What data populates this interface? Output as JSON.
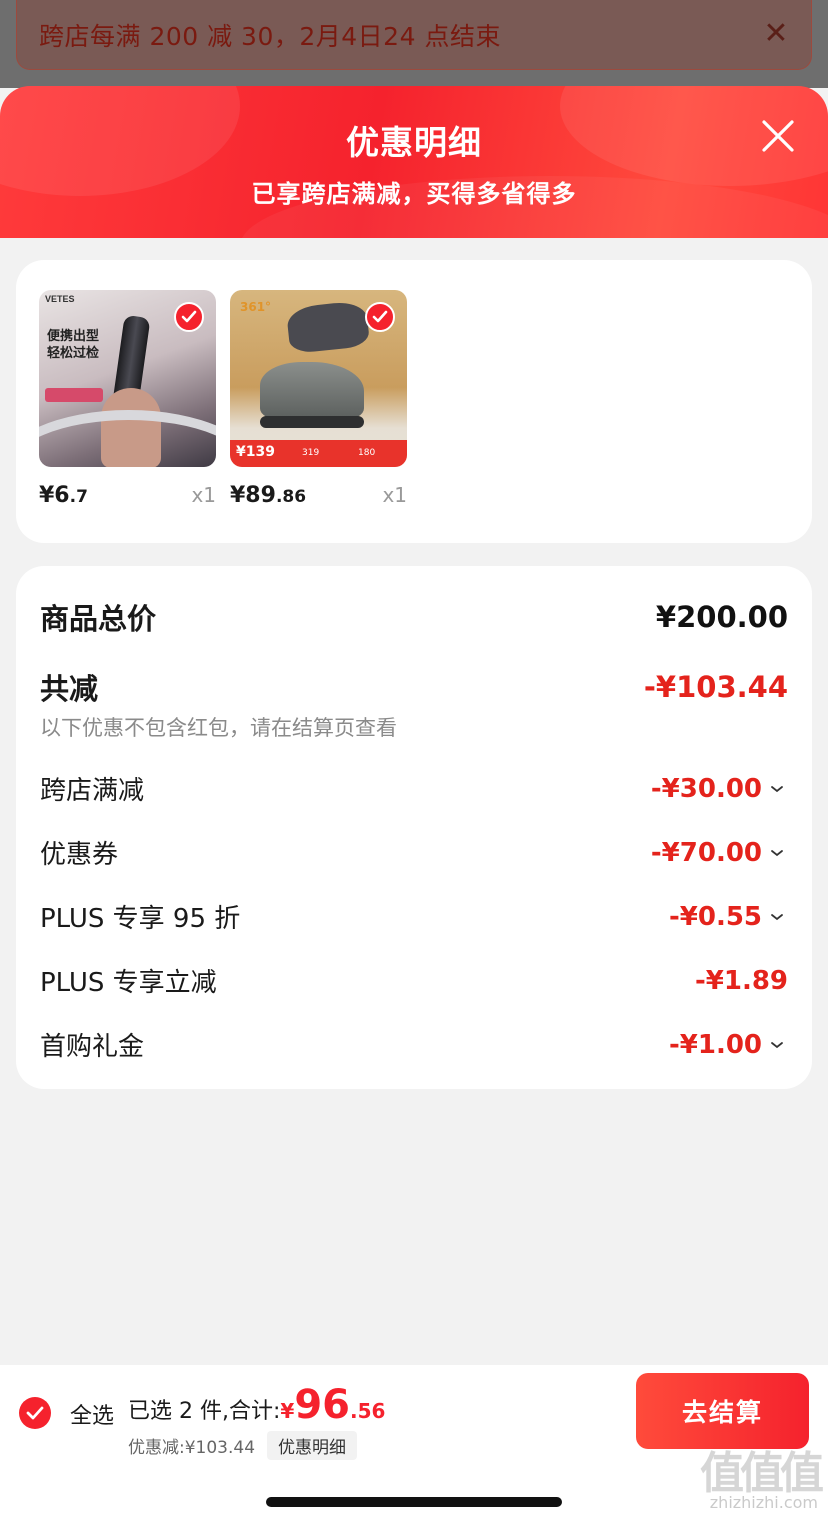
{
  "promo_banner": {
    "text": "跨店每满 200 减 30，2月4日24 点结束",
    "close_icon": "close-icon"
  },
  "header": {
    "title": "优惠明细",
    "subtitle": "已享跨店满减，买得多省得多",
    "close_icon": "close-icon"
  },
  "products": [
    {
      "price_int": "¥6",
      "price_dec": ".7",
      "qty": "x1",
      "thumb_text": "便携出型\n轻松过检",
      "brand": "VETES",
      "selected": true
    },
    {
      "price_int": "¥89",
      "price_dec": ".86",
      "qty": "x1",
      "thumb_brand": "361°",
      "thumb_price": "¥139",
      "selected": true
    }
  ],
  "summary": {
    "goods_total_label": "商品总价",
    "goods_total_value": "¥200.00",
    "total_discount_label": "共减",
    "total_discount_value": "-¥103.44",
    "note": "以下优惠不包含红包，请在结算页查看",
    "items": [
      {
        "label": "跨店满减",
        "value": "-¥30.00",
        "expandable": true
      },
      {
        "label": "优惠券",
        "value": "-¥70.00",
        "expandable": true
      },
      {
        "label": "PLUS 专享 95 折",
        "value": "-¥0.55",
        "expandable": true
      },
      {
        "label": "PLUS 专享立减",
        "value": "-¥1.89",
        "expandable": false
      },
      {
        "label": "首购礼金",
        "value": "-¥1.00",
        "expandable": true
      }
    ]
  },
  "bottom_bar": {
    "select_all_label": "全选",
    "selected_text": "已选 2 件,合计:",
    "total_symbol": "¥",
    "total_int": "96",
    "total_dec": ".56",
    "discount_text": "优惠减:¥103.44",
    "detail_button": "优惠明细",
    "checkout_button": "去结算"
  },
  "watermark": {
    "text": "值值值",
    "url": "zhizhizhi.com"
  },
  "colors": {
    "accent": "#f5222d",
    "discount_red": "#e4231c",
    "background": "#f2f2f2"
  }
}
